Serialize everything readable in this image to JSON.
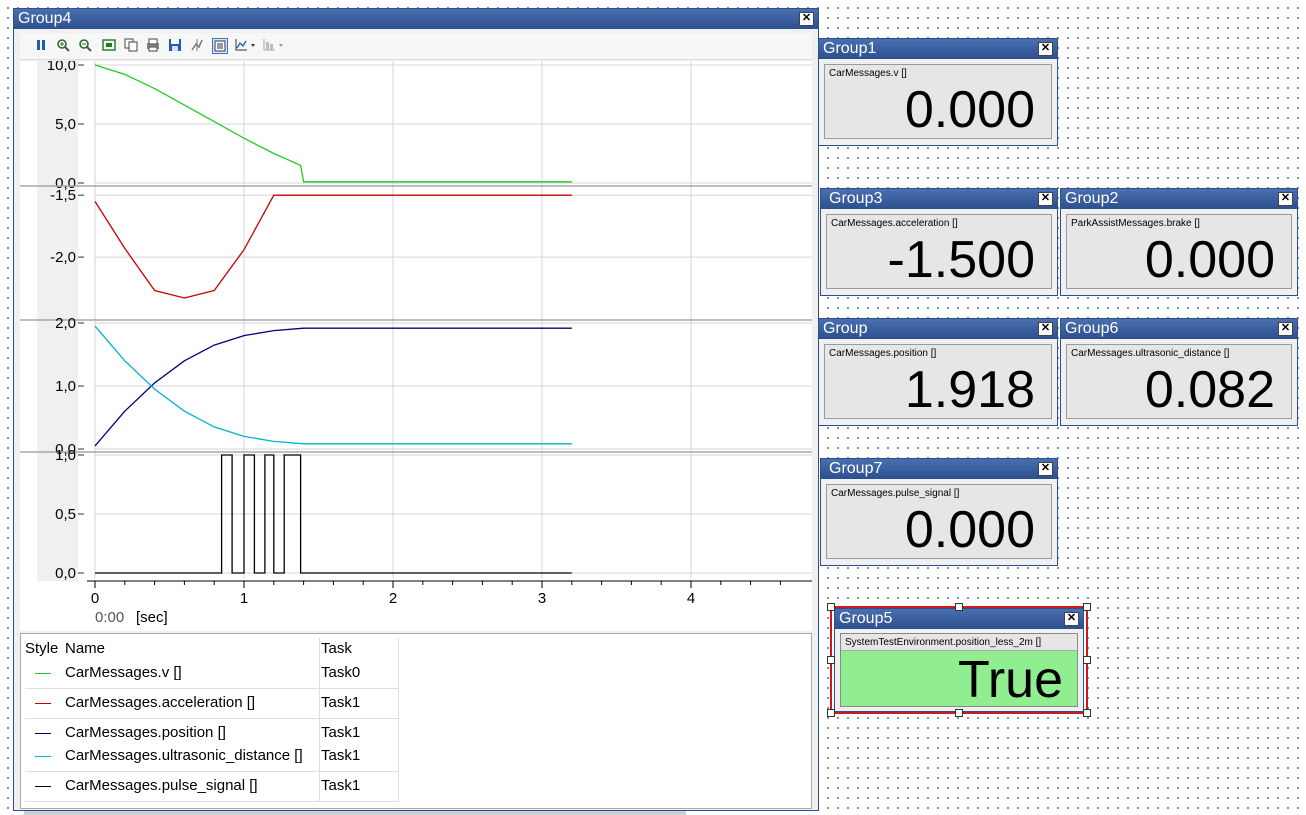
{
  "group4": {
    "title": "Group4",
    "close": "✕",
    "toolbar_icons": [
      "pause-icon",
      "zoom-in-icon",
      "zoom-out-icon",
      "fit-icon",
      "copy-icon",
      "print-icon",
      "save-icon",
      "cursor-icon",
      "list-icon",
      "axis-menu-icon",
      "settings-menu-icon"
    ],
    "x_axis_unit": "[sec]",
    "x_time_label": "0:00",
    "legend": {
      "headers": [
        "Style",
        "Name",
        "Task"
      ],
      "rows": [
        {
          "name": "CarMessages.v []",
          "task": "Task0",
          "color": "#22cc22"
        },
        {
          "name": "CarMessages.acceleration []",
          "task": "Task1",
          "color": "#cc0000"
        },
        {
          "name": "CarMessages.position []",
          "task": "Task1",
          "color": "#000080"
        },
        {
          "name": "CarMessages.ultrasonic_distance []",
          "task": "Task1",
          "color": "#00b4c8"
        },
        {
          "name": "CarMessages.pulse_signal []",
          "task": "Task1",
          "color": "#000000"
        }
      ]
    }
  },
  "chart_data": {
    "type": "line",
    "x_ticks": [
      "0",
      "1",
      "2",
      "3",
      "4"
    ],
    "xlim": [
      0,
      4.8
    ],
    "panels": [
      {
        "yticks": [
          "10,0",
          "5,0",
          "0,0"
        ],
        "ylim": [
          0,
          10
        ],
        "series": [
          {
            "name": "CarMessages.v []",
            "color": "#22cc22",
            "x": [
              0,
              0.2,
              0.4,
              0.6,
              0.8,
              1.0,
              1.2,
              1.38,
              1.4,
              3.2
            ],
            "y": [
              10,
              9.2,
              8.0,
              6.6,
              5.2,
              3.8,
              2.5,
              1.5,
              0.1,
              0.1
            ]
          }
        ]
      },
      {
        "yticks": [
          "-1,5",
          "-2,0"
        ],
        "ylim": [
          -2.5,
          -1.45
        ],
        "series": [
          {
            "name": "CarMessages.acceleration []",
            "color": "#cc0000",
            "x": [
              0,
              0.2,
              0.4,
              0.6,
              0.8,
              1.0,
              1.2,
              3.2
            ],
            "y": [
              -1.55,
              -1.93,
              -2.27,
              -2.33,
              -2.27,
              -1.94,
              -1.5,
              -1.5
            ]
          }
        ]
      },
      {
        "yticks": [
          "2,0",
          "1,0",
          "0,0"
        ],
        "ylim": [
          0,
          2
        ],
        "series": [
          {
            "name": "CarMessages.position []",
            "color": "#000080",
            "x": [
              0,
              0.2,
              0.4,
              0.6,
              0.8,
              1.0,
              1.2,
              1.4,
              3.2
            ],
            "y": [
              0.05,
              0.6,
              1.05,
              1.4,
              1.65,
              1.8,
              1.88,
              1.918,
              1.918
            ]
          },
          {
            "name": "CarMessages.ultrasonic_distance []",
            "color": "#00b4c8",
            "x": [
              0,
              0.2,
              0.4,
              0.6,
              0.8,
              1.0,
              1.2,
              1.4,
              3.2
            ],
            "y": [
              1.95,
              1.4,
              0.95,
              0.6,
              0.35,
              0.2,
              0.12,
              0.082,
              0.082
            ]
          }
        ]
      },
      {
        "yticks": [
          "1,0",
          "0,5",
          "0,0"
        ],
        "ylim": [
          0,
          1
        ],
        "series": [
          {
            "name": "CarMessages.pulse_signal []",
            "color": "#000000",
            "x": [
              0,
              0.85,
              0.85,
              0.92,
              0.92,
              1.0,
              1.0,
              1.07,
              1.07,
              1.14,
              1.14,
              1.2,
              1.2,
              1.27,
              1.27,
              1.38,
              1.38,
              3.2
            ],
            "y": [
              0,
              0,
              1,
              1,
              0,
              0,
              1,
              1,
              0,
              0,
              1,
              1,
              0,
              0,
              1,
              1,
              0,
              0
            ]
          }
        ]
      }
    ]
  },
  "groups": [
    {
      "id": "group1",
      "title": "Group1",
      "signal": "CarMessages.v []",
      "value": "0.000"
    },
    {
      "id": "group3",
      "title": "Group3",
      "signal": "CarMessages.acceleration []",
      "value": "-1.500"
    },
    {
      "id": "group2",
      "title": "Group2",
      "signal": "ParkAssistMessages.brake []",
      "value": "0.000"
    },
    {
      "id": "group",
      "title": "Group",
      "signal": "CarMessages.position []",
      "value": "1.918"
    },
    {
      "id": "group6",
      "title": "Group6",
      "signal": "CarMessages.ultrasonic_distance []",
      "value": "0.082"
    },
    {
      "id": "group7",
      "title": "Group7",
      "signal": "CarMessages.pulse_signal []",
      "value": "0.000"
    },
    {
      "id": "group5",
      "title": "Group5",
      "signal": "SystemTestEnvironment.position_less_2m []",
      "value": "True",
      "bg": "#90ee90"
    }
  ]
}
